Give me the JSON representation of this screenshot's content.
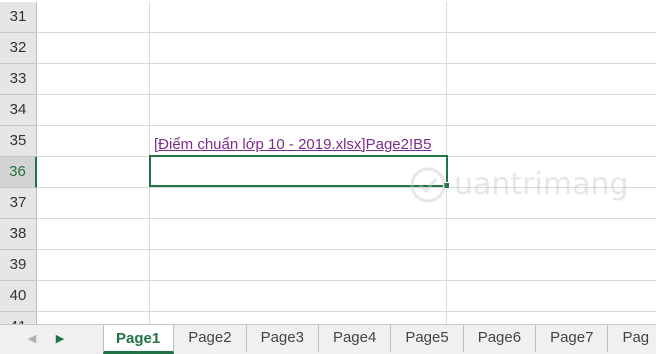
{
  "rows": [
    {
      "num": "31",
      "b": ""
    },
    {
      "num": "32",
      "b": ""
    },
    {
      "num": "33",
      "b": ""
    },
    {
      "num": "34",
      "b": ""
    },
    {
      "num": "35",
      "b": "[Điểm chuẩn lớp 10 - 2019.xlsx]Page2!B5"
    },
    {
      "num": "36",
      "b": ""
    },
    {
      "num": "37",
      "b": ""
    },
    {
      "num": "38",
      "b": ""
    },
    {
      "num": "39",
      "b": ""
    },
    {
      "num": "40",
      "b": ""
    },
    {
      "num": "41",
      "b": ""
    }
  ],
  "selected_row": "36",
  "sheet_tabs": [
    "Page1",
    "Page2",
    "Page3",
    "Page4",
    "Page5",
    "Page6",
    "Page7",
    "Pag"
  ],
  "active_tab": "Page1",
  "navigation": {
    "prev_icon": "triangle-left-icon",
    "next_icon": "triangle-right-icon"
  },
  "watermark": {
    "text": "uantrimang",
    "logo": "quantrimang-logo"
  },
  "colors": {
    "accent": "#217346",
    "hyperlink": "#7b2c8d"
  }
}
